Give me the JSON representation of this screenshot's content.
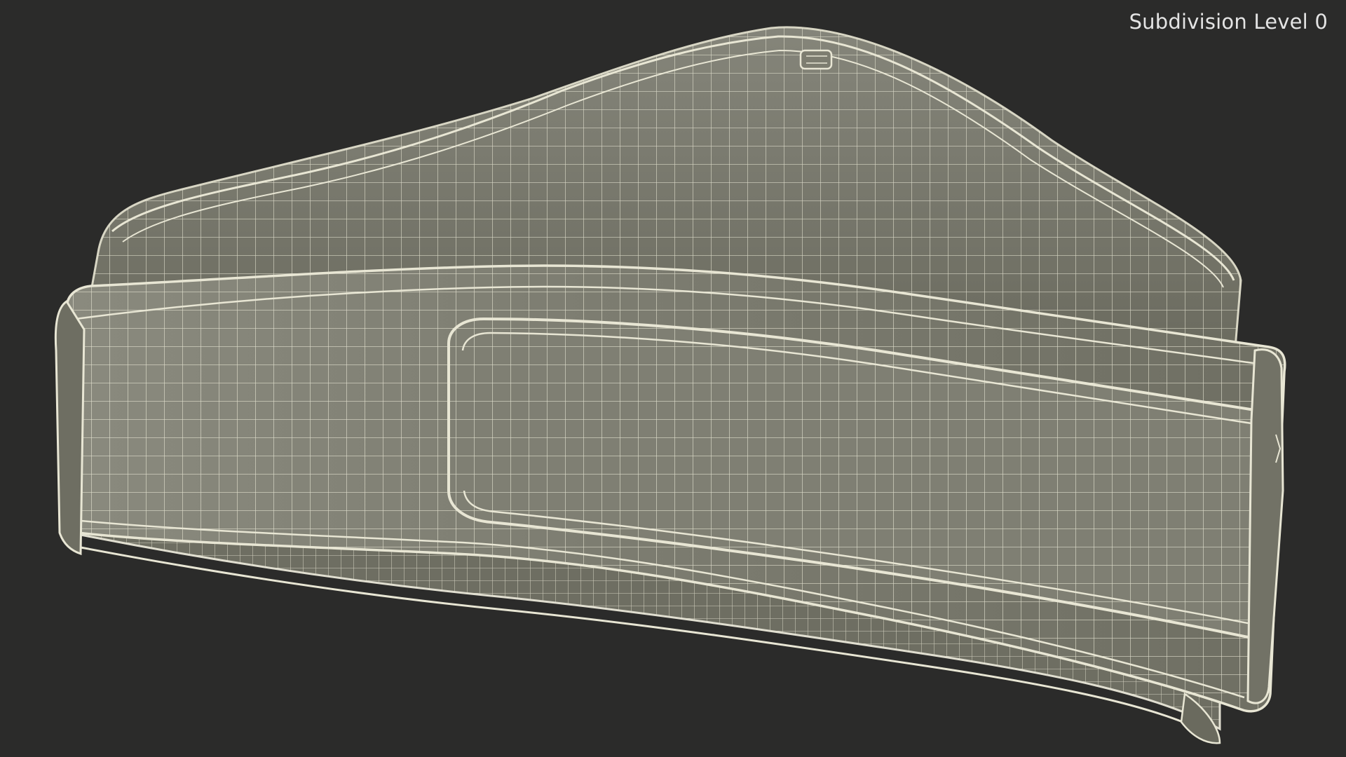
{
  "viewport": {
    "subdivision_label": "Subdivision Level 0",
    "background_color": "#2b2b2a",
    "mesh_fill_color": "#7a7a6c",
    "wire_color": "#e8e6d4"
  }
}
